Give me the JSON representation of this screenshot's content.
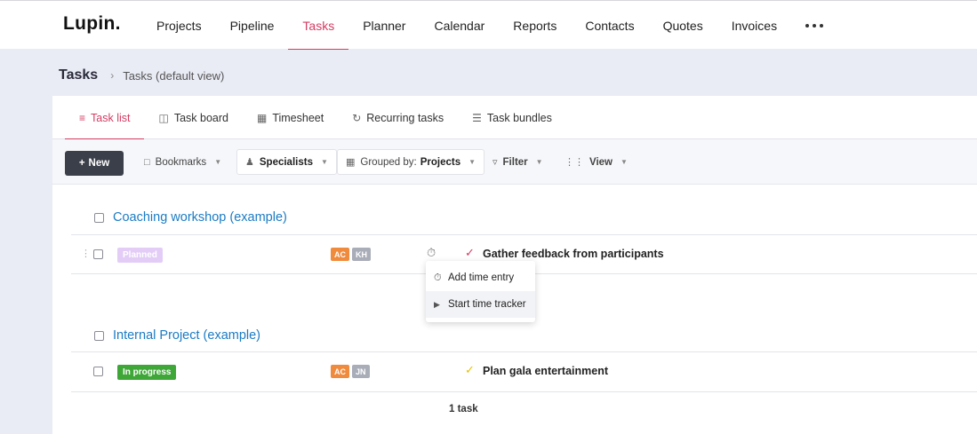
{
  "app": {
    "logo": "Lupin."
  },
  "nav": {
    "items": [
      "Projects",
      "Pipeline",
      "Tasks",
      "Planner",
      "Calendar",
      "Reports",
      "Contacts",
      "Quotes",
      "Invoices"
    ],
    "active": "Tasks"
  },
  "breadcrumb": {
    "title": "Tasks",
    "current": "Tasks (default view)"
  },
  "tabs": [
    {
      "label": "Task list",
      "icon": "list-icon"
    },
    {
      "label": "Task board",
      "icon": "board-icon"
    },
    {
      "label": "Timesheet",
      "icon": "grid-icon"
    },
    {
      "label": "Recurring tasks",
      "icon": "refresh-icon"
    },
    {
      "label": "Task bundles",
      "icon": "bundle-icon"
    }
  ],
  "toolbar": {
    "new_label": "New",
    "bookmarks_label": "Bookmarks",
    "specialists_label": "Specialists",
    "grouped_prefix": "Grouped by:",
    "grouped_value": "Projects",
    "filter_label": "Filter",
    "view_label": "View"
  },
  "groups": [
    {
      "title": "Coaching workshop (example)",
      "task": {
        "status": "Planned",
        "avatars": [
          "AC",
          "KH"
        ],
        "name": "Gather feedback from participants"
      }
    },
    {
      "title": "Internal Project (example)",
      "task": {
        "status": "In progress",
        "avatars": [
          "AC",
          "JN"
        ],
        "name": "Plan gala entertainment"
      }
    }
  ],
  "popup": {
    "add_time_entry": "Add time entry",
    "start_time_tracker": "Start time tracker"
  },
  "footer": {
    "count": "1 task"
  },
  "colors": {
    "accent": "#d43d62",
    "link": "#1b7bc4",
    "in_progress": "#3ea737",
    "planned": "#e3cdf7",
    "avatar_orange": "#f08a3c",
    "avatar_gray": "#a9adb8"
  }
}
